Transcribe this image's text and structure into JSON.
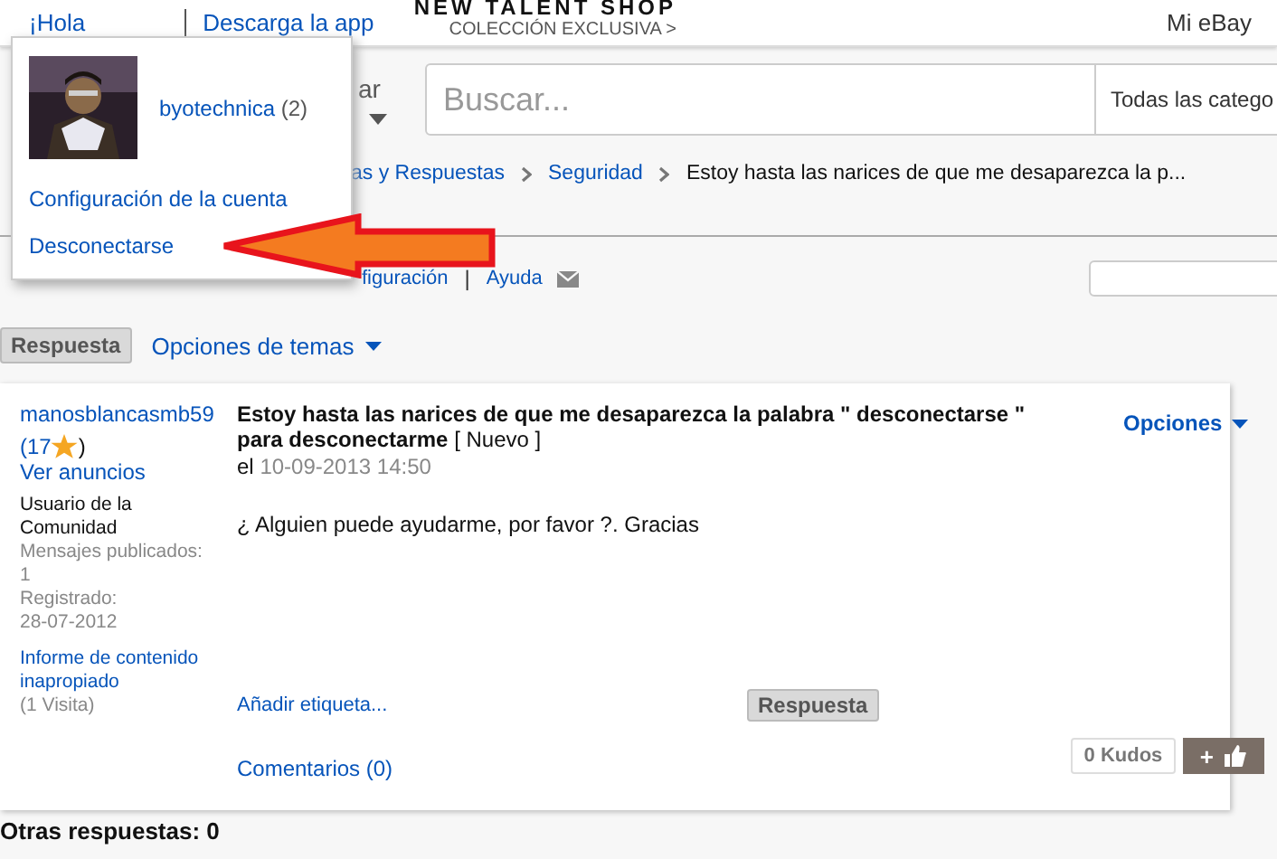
{
  "top_bar": {
    "greeting": "¡Hola",
    "app_link": "Descarga la app",
    "promo_title": "NEW TALENT SHOP",
    "promo_subtitle": "COLECCIÓN EXCLUSIVA >",
    "my_ebay": "Mi eBay"
  },
  "search_row": {
    "category_menu_fragment": "ar",
    "search": {
      "placeholder": "Buscar..."
    },
    "category_select": "Todas las catego"
  },
  "breadcrumb": [
    "as y Respuestas",
    "Seguridad",
    "Estoy hasta las narices de que me desaparezca la p..."
  ],
  "board_links": {
    "settings_fragment": "figuración",
    "separator": "|",
    "help": "Ayuda"
  },
  "toolbar": {
    "reply": "Respuesta",
    "topic_options": "Opciones de temas"
  },
  "post": {
    "author": "manosblancasmb59",
    "feedback": "(17",
    "feedback_close": ")",
    "see_listings": "Ver anuncios",
    "rank": "Usuario de la Comunidad",
    "posts_label": "Mensajes publicados:",
    "posts": "1",
    "registered_label": "Registrado:",
    "registered": "28-07-2012",
    "report": "Informe de contenido inapropiado",
    "visits": "(1 Visita)",
    "title": "Estoy hasta las narices de que me desaparezca la palabra \" desconectarse \" para desconectarme",
    "new_tag": "[ Nuevo ]",
    "date_prefix": "el",
    "date": "10-09-2013 14:50",
    "body": "¿ Alguien puede ayudarme, por favor ?. Gracias",
    "options": "Opciones",
    "add_tag": "Añadir etiqueta...",
    "reply": "Respuesta",
    "comments": "Comentarios (0)",
    "kudos": "0 Kudos",
    "kudo_plus": "+"
  },
  "other_replies": "Otras respuestas: 0",
  "user_menu": {
    "avatar": {
      "kind": "picture"
    },
    "username": "byotechnica",
    "score": "(2)",
    "items": [
      "Configuración de la cuenta",
      "Desconectarse"
    ]
  }
}
